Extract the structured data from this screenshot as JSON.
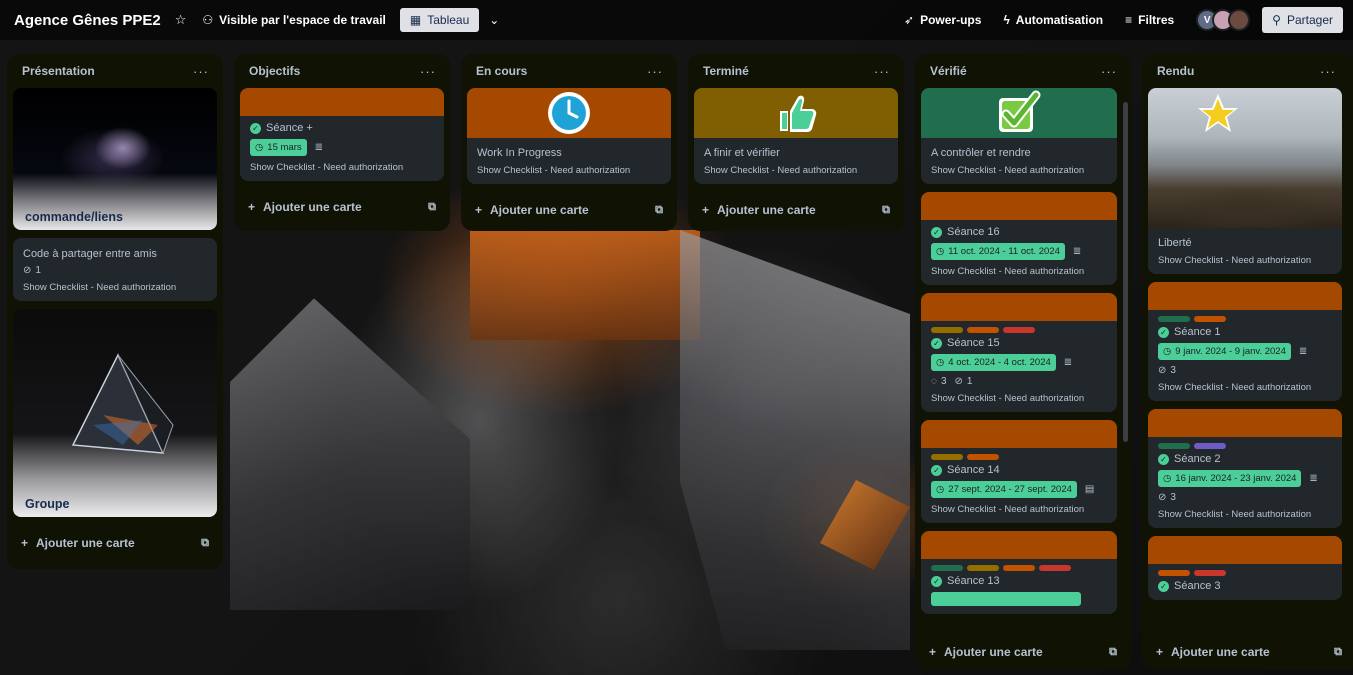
{
  "header": {
    "board_title": "Agence Gênes PPE2",
    "visibility": "Visible par l'espace de travail",
    "view": "Tableau",
    "powerups": "Power-ups",
    "automation": "Automatisation",
    "filters": "Filtres",
    "avatar_initial": "V",
    "share": "Partager"
  },
  "colors": {
    "orange": "#a54800",
    "olive": "#7f5f01",
    "green": "#216e4e",
    "date_green": "#4bce97"
  },
  "add_card": "Ajouter une carte",
  "lists": {
    "presentation": {
      "title": "Présentation",
      "cards": [
        {
          "title": "commande/liens"
        },
        {
          "title": "Code à partager entre amis",
          "attachments": "1",
          "meta": "Show Checklist - Need authorization"
        },
        {
          "title": "Groupe"
        }
      ]
    },
    "objectifs": {
      "title": "Objectifs",
      "cards": [
        {
          "title": "Séance +",
          "date": "15 mars",
          "meta": "Show Checklist - Need authorization"
        }
      ]
    },
    "encours": {
      "title": "En cours",
      "cards": [
        {
          "title": "Work In Progress",
          "meta": "Show Checklist - Need authorization"
        }
      ]
    },
    "termine": {
      "title": "Terminé",
      "cards": [
        {
          "title": "A finir et vérifier",
          "meta": "Show Checklist - Need authorization"
        }
      ]
    },
    "verifie": {
      "title": "Vérifié",
      "cards": [
        {
          "title": "A contrôler et rendre",
          "meta": "Show Checklist - Need authorization"
        },
        {
          "title": "Séance 16",
          "date": "11 oct. 2024 - 11 oct. 2024",
          "meta": "Show Checklist - Need authorization"
        },
        {
          "title": "Séance 15",
          "date": "4 oct. 2024 - 4 oct. 2024",
          "comments": "3",
          "attachments": "1",
          "meta": "Show Checklist - Need authorization"
        },
        {
          "title": "Séance 14",
          "date": "27 sept. 2024 - 27 sept. 2024",
          "meta": "Show Checklist - Need authorization"
        },
        {
          "title": "Séance 13"
        }
      ]
    },
    "rendu": {
      "title": "Rendu",
      "cards": [
        {
          "title": "Liberté",
          "meta": "Show Checklist - Need authorization"
        },
        {
          "title": "Séance 1",
          "date": "9 janv. 2024 - 9 janv. 2024",
          "attachments": "3",
          "meta": "Show Checklist - Need authorization"
        },
        {
          "title": "Séance 2",
          "date": "16 janv. 2024 - 23 janv. 2024",
          "attachments": "3",
          "meta": "Show Checklist - Need authorization"
        },
        {
          "title": "Séance 3"
        }
      ]
    }
  }
}
